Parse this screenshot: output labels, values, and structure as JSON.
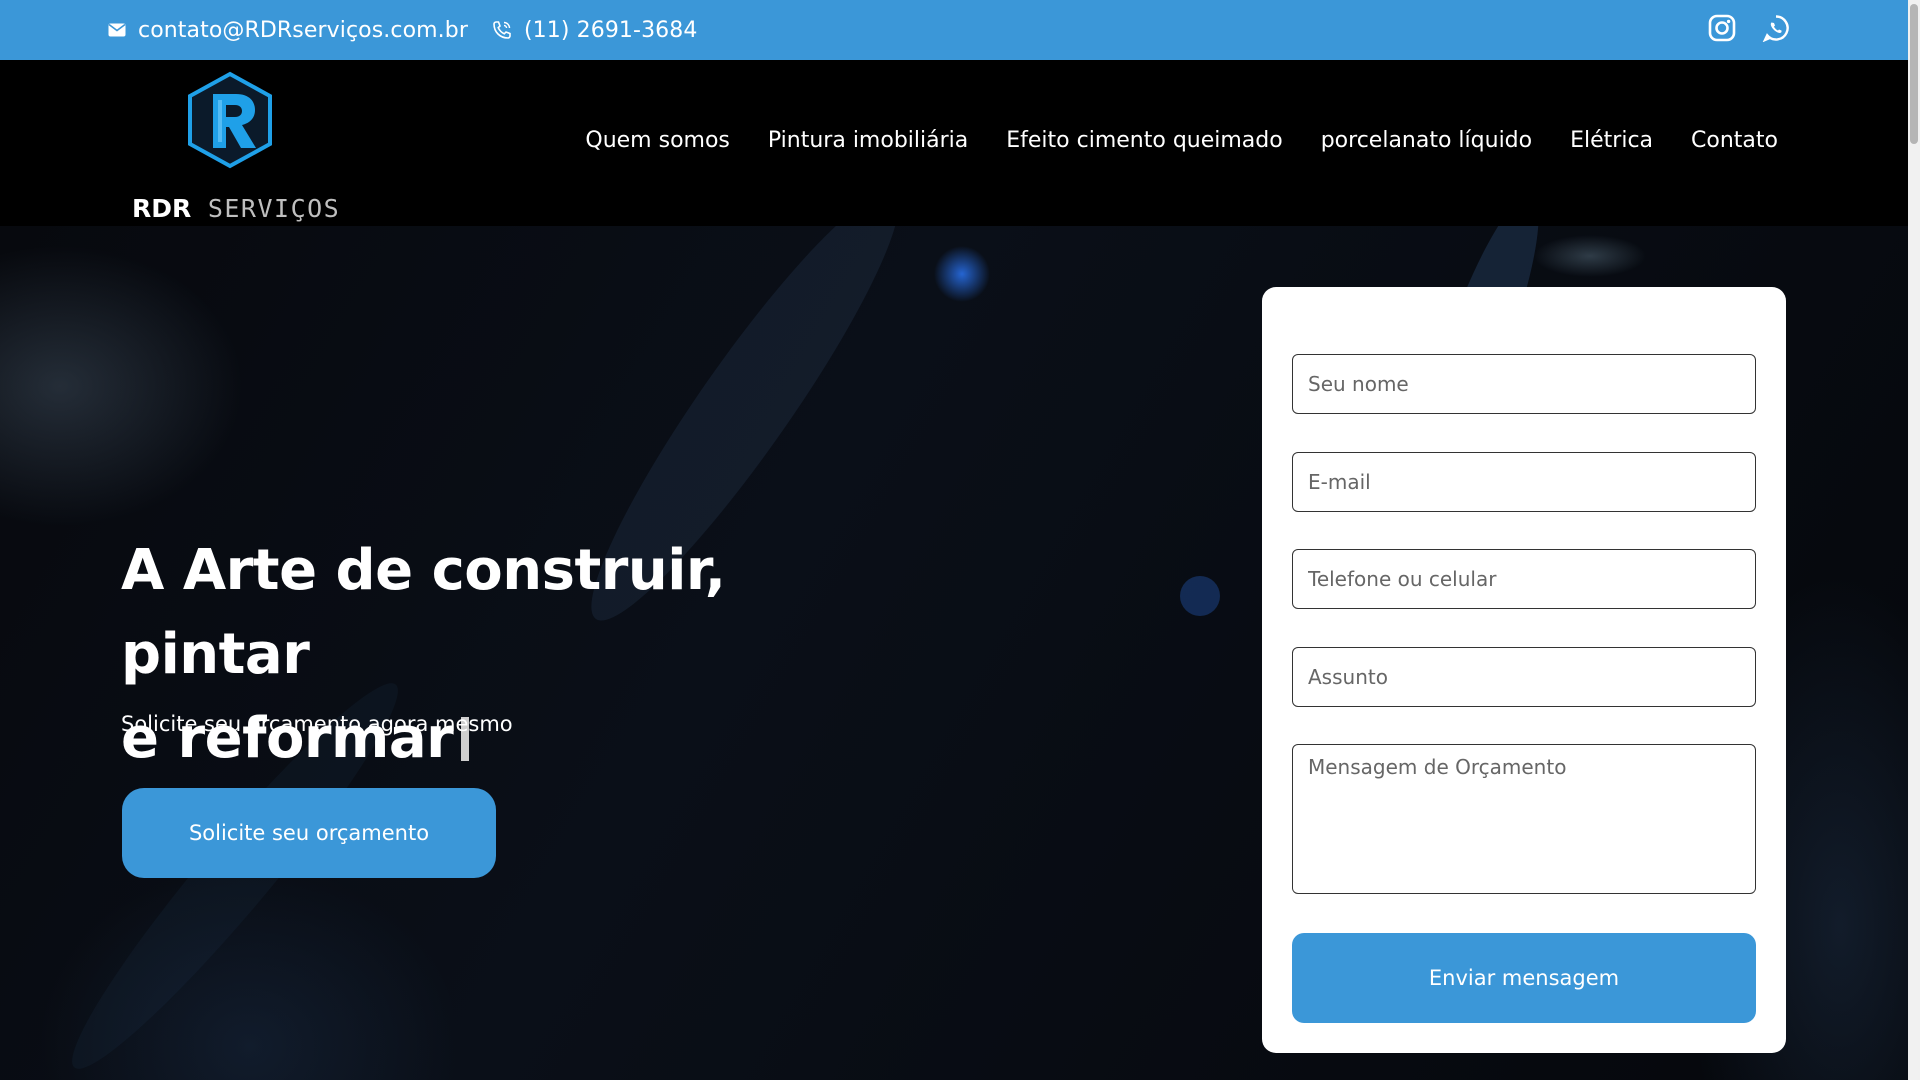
{
  "colors": {
    "accent": "#3b97d8",
    "header_bg": "#000000",
    "card_bg": "#ffffff"
  },
  "topbar": {
    "email": "contato@RDRserviços.com.br",
    "phone": "(11) 2691-3684",
    "email_icon": "envelope-icon",
    "phone_icon": "phone-icon",
    "socials": [
      "instagram-icon",
      "whatsapp-icon"
    ]
  },
  "logo": {
    "bold": "RDR",
    "light": " SERVIÇOS"
  },
  "nav": {
    "items": [
      {
        "label": "Quem somos"
      },
      {
        "label": "Pintura imobiliária"
      },
      {
        "label": "Efeito cimento queimado"
      },
      {
        "label": "porcelanato líquido"
      },
      {
        "label": "Elétrica"
      },
      {
        "label": "Contato"
      }
    ]
  },
  "hero": {
    "title_line1": "A Arte de construir, pintar",
    "title_line2": "e reformar",
    "subtitle": "Solicite seu orçamento agora mesmo",
    "cta": "Solicite seu orçamento"
  },
  "form": {
    "name_placeholder": "Seu nome",
    "email_placeholder": "E-mail",
    "phone_placeholder": "Telefone ou celular",
    "subject_placeholder": "Assunto",
    "message_placeholder": "Mensagem de Orçamento",
    "submit": "Enviar mensagem"
  }
}
